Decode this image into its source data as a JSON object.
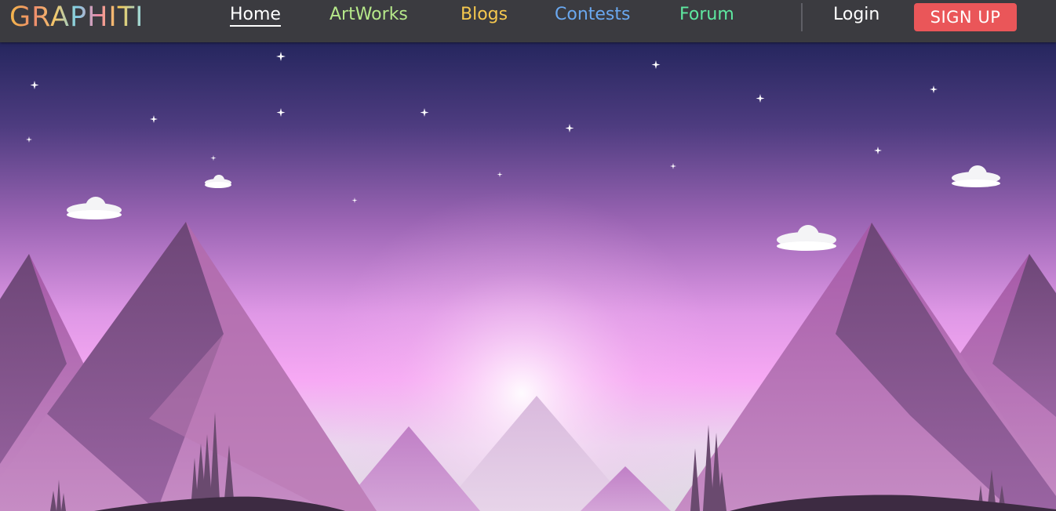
{
  "brand": {
    "logo_text": "GRAPHITI"
  },
  "nav": {
    "links": [
      {
        "label": "Home",
        "color": "#ffffff",
        "active": true
      },
      {
        "label": "ArtWorks",
        "color": "#b6e88a"
      },
      {
        "label": "Blogs",
        "color": "#f6c84e"
      },
      {
        "label": "Contests",
        "color": "#6aa8f0"
      },
      {
        "label": "Forum",
        "color": "#5ee8a0"
      }
    ],
    "login_label": "Login",
    "signup_label": "SIGN UP"
  },
  "colors": {
    "navbar_bg": "#3b3b40",
    "signup_bg": "#ea5659",
    "sky_top": "#25265e",
    "sky_mid": "#c58ad9",
    "horizon_glow": "#f8a8f5"
  },
  "hero": {
    "scene": "night-sky-mountain-landscape",
    "icons": [
      "star-icon",
      "cloud-icon",
      "mountain-icon",
      "tree-icon"
    ]
  }
}
